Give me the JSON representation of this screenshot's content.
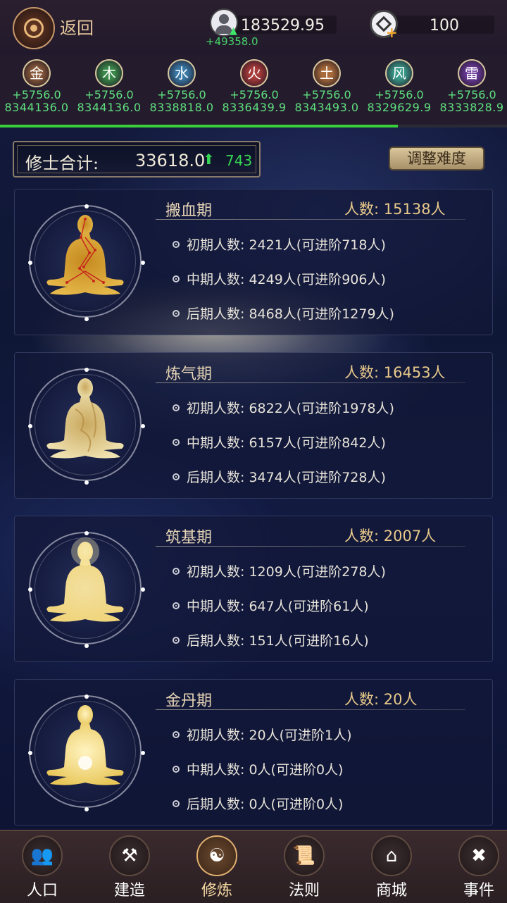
{
  "header": {
    "back_label": "返回",
    "population": "183529.95",
    "population_delta": "+49358.0",
    "currency": "100"
  },
  "elements": [
    {
      "name": "金",
      "rate": "+5756.0",
      "total": "8344136.0",
      "color": "#8a5a3a"
    },
    {
      "name": "木",
      "rate": "+5756.0",
      "total": "8344136.0",
      "color": "#3a8a4a"
    },
    {
      "name": "水",
      "rate": "+5756.0",
      "total": "8338818.0",
      "color": "#3a7aa8"
    },
    {
      "name": "火",
      "rate": "+5756.0",
      "total": "8336439.9",
      "color": "#a83a3a"
    },
    {
      "name": "土",
      "rate": "+5756.0",
      "total": "8343493.0",
      "color": "#a86a3a"
    },
    {
      "name": "风",
      "rate": "+5756.0",
      "total": "8329629.9",
      "color": "#3a9a8a"
    },
    {
      "name": "雷",
      "rate": "+5756.0",
      "total": "8333828.9",
      "color": "#6a3a9a"
    }
  ],
  "progress_fraction": 0.785,
  "summary": {
    "label": "修士合计:",
    "total": "33618.0",
    "delta": "743",
    "difficulty_button": "调整难度"
  },
  "stages": [
    {
      "name": "搬血期",
      "count": "人数: 15138人",
      "rows": [
        "初期人数: 2421人(可进阶718人)",
        "中期人数: 4249人(可进阶906人)",
        "后期人数: 8468人(可进阶1279人)"
      ]
    },
    {
      "name": "炼气期",
      "count": "人数: 16453人",
      "rows": [
        "初期人数: 6822人(可进阶1978人)",
        "中期人数: 6157人(可进阶842人)",
        "后期人数: 3474人(可进阶728人)"
      ]
    },
    {
      "name": "筑基期",
      "count": "人数: 2007人",
      "rows": [
        "初期人数: 1209人(可进阶278人)",
        "中期人数: 647人(可进阶61人)",
        "后期人数: 151人(可进阶16人)"
      ]
    },
    {
      "name": "金丹期",
      "count": "人数: 20人",
      "rows": [
        "初期人数: 20人(可进阶1人)",
        "中期人数: 0人(可进阶0人)",
        "后期人数: 0人(可进阶0人)"
      ]
    }
  ],
  "nav": [
    {
      "label": "人口",
      "icon": "people-icon"
    },
    {
      "label": "建造",
      "icon": "tools-icon"
    },
    {
      "label": "修炼",
      "icon": "meditation-icon",
      "active": true
    },
    {
      "label": "法则",
      "icon": "law-scroll-icon"
    },
    {
      "label": "商城",
      "icon": "shop-icon"
    },
    {
      "label": "事件",
      "icon": "event-book-icon"
    }
  ]
}
